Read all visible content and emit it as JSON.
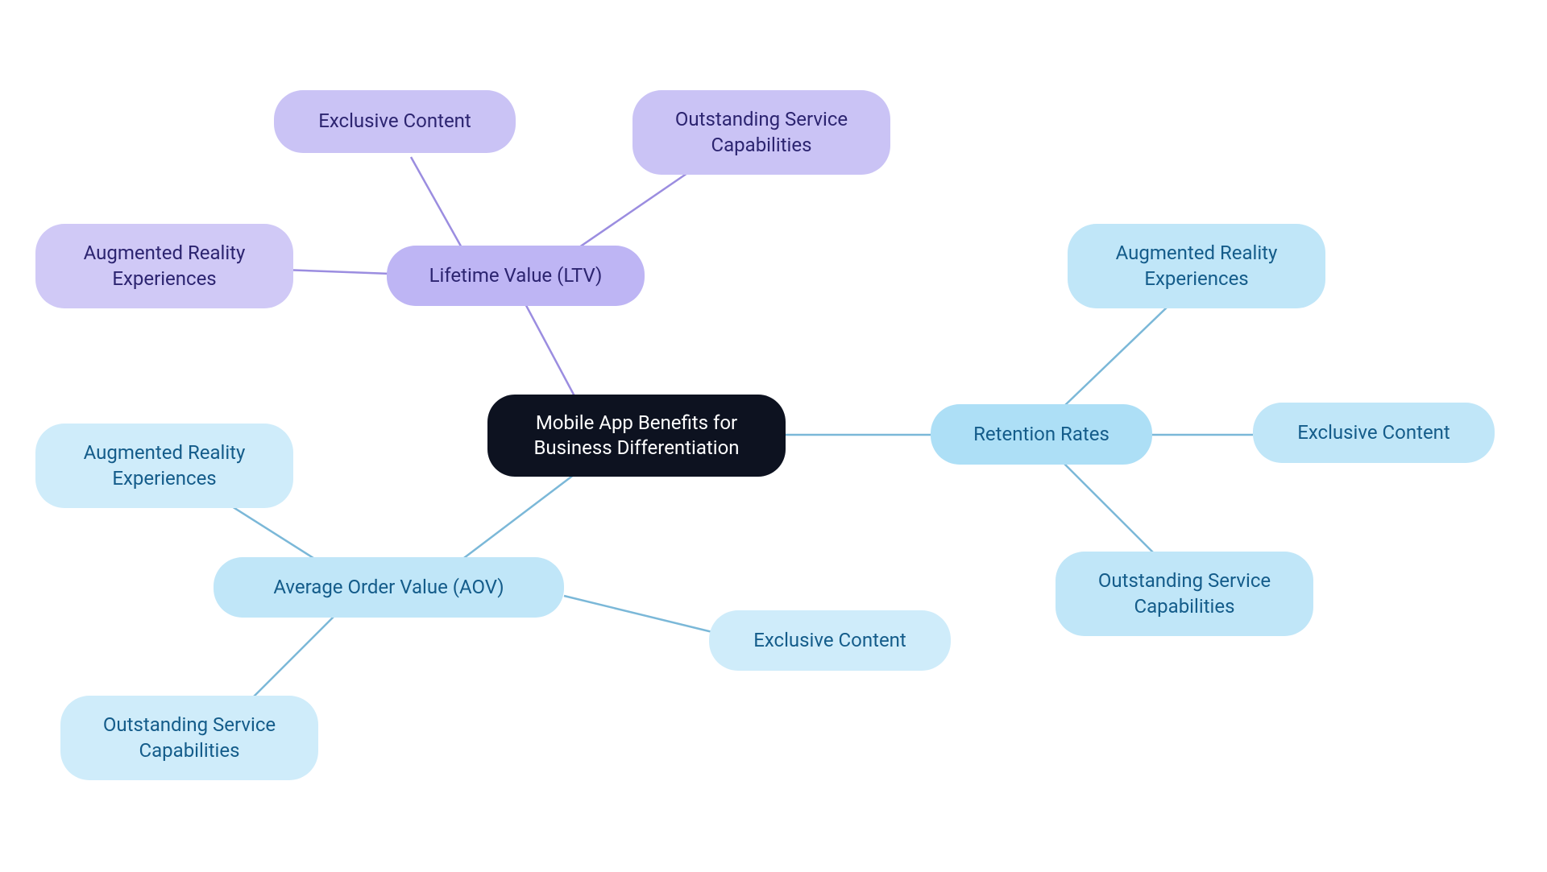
{
  "center": {
    "label": "Mobile App Benefits for Business Differentiation"
  },
  "ltv": {
    "label": "Lifetime Value (LTV)",
    "children": {
      "exclusive": "Exclusive Content",
      "service": "Outstanding Service Capabilities",
      "ar": "Augmented Reality Experiences"
    }
  },
  "retention": {
    "label": "Retention Rates",
    "children": {
      "ar": "Augmented Reality Experiences",
      "exclusive": "Exclusive Content",
      "service": "Outstanding Service Capabilities"
    }
  },
  "aov": {
    "label": "Average Order Value (AOV)",
    "children": {
      "ar": "Augmented Reality Experiences",
      "exclusive": "Exclusive Content",
      "service": "Outstanding Service Capabilities"
    }
  }
}
